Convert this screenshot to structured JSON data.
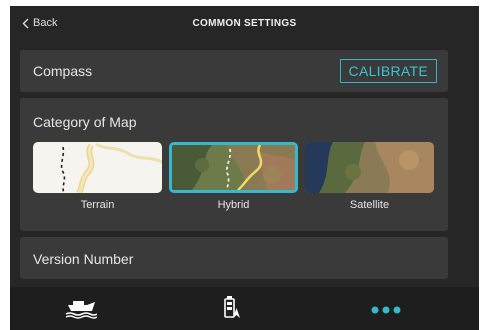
{
  "header": {
    "back_label": "Back",
    "title": "COMMON SETTINGS"
  },
  "compass": {
    "label": "Compass",
    "calibrate_label": "CALIBRATE"
  },
  "map_category": {
    "title": "Category of Map",
    "options": [
      {
        "label": "Terrain",
        "selected": false
      },
      {
        "label": "Hybrid",
        "selected": true
      },
      {
        "label": "Satellite",
        "selected": false
      }
    ]
  },
  "version": {
    "label": "Version Number"
  },
  "bottom_nav": {
    "icons": [
      "boat-icon",
      "autopilot-icon",
      "more-icon"
    ]
  },
  "colors": {
    "accent": "#35b9cb",
    "background": "#262626",
    "card": "#3a3a3a"
  }
}
